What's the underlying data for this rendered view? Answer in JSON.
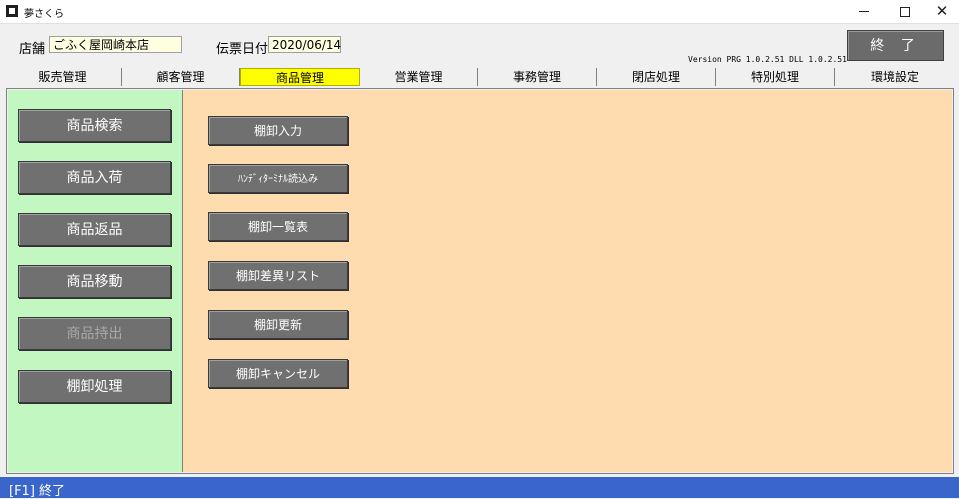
{
  "window": {
    "title": "夢さくら"
  },
  "header": {
    "store_label": "店舗",
    "store_value": "ごふく屋岡崎本店",
    "date_label": "伝票日付",
    "date_value": "2020/06/14",
    "version": "Version PRG 1.0.2.51 DLL 1.0.2.51",
    "end_button": "終 了"
  },
  "tabs": [
    {
      "label": "販売管理",
      "active": false
    },
    {
      "label": "顧客管理",
      "active": false
    },
    {
      "label": "商品管理",
      "active": true
    },
    {
      "label": "営業管理",
      "active": false
    },
    {
      "label": "事務管理",
      "active": false
    },
    {
      "label": "閉店処理",
      "active": false
    },
    {
      "label": "特別処理",
      "active": false
    },
    {
      "label": "環境設定",
      "active": false
    }
  ],
  "left_menu": [
    {
      "label": "商品検索",
      "enabled": true
    },
    {
      "label": "商品入荷",
      "enabled": true
    },
    {
      "label": "商品返品",
      "enabled": true
    },
    {
      "label": "商品移動",
      "enabled": true
    },
    {
      "label": "商品持出",
      "enabled": false
    },
    {
      "label": "棚卸処理",
      "enabled": true
    }
  ],
  "right_menu": [
    {
      "label": "棚卸入力"
    },
    {
      "label": "ﾊﾝﾃﾞｨﾀｰﾐﾅﾙ読込み"
    },
    {
      "label": "棚卸一覧表"
    },
    {
      "label": "棚卸差異リスト"
    },
    {
      "label": "棚卸更新"
    },
    {
      "label": "棚卸キャンセル"
    }
  ],
  "status": {
    "text": "[F1] 終了"
  },
  "colors": {
    "active_tab": "#ffff00",
    "left_panel": "#c2f7c2",
    "right_panel": "#fedcb0",
    "status_bar": "#3a66cc",
    "button": "#707070"
  }
}
